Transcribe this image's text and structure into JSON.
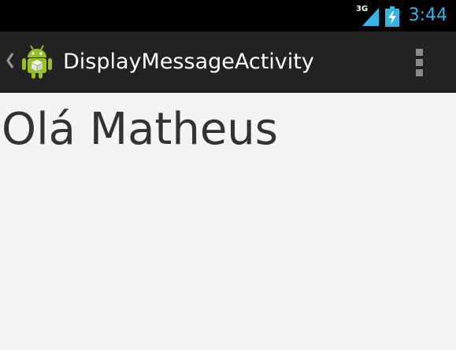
{
  "status_bar": {
    "network_type": "3G",
    "time": "3:44",
    "time_color": "#33b5e5",
    "icons": [
      "signal-icon",
      "battery-charging-icon"
    ]
  },
  "action_bar": {
    "title": "DisplayMessageActivity",
    "icons": [
      "back-caret-icon",
      "android-app-icon",
      "overflow-menu-icon"
    ]
  },
  "content": {
    "message": "Olá Matheus"
  }
}
